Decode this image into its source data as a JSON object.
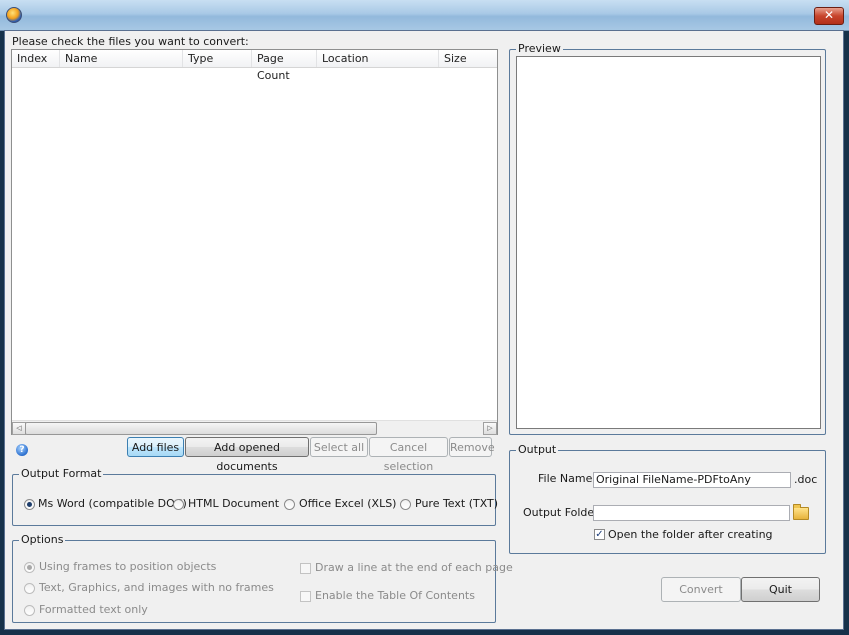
{
  "window": {
    "title": "",
    "close_label": "✕"
  },
  "files": {
    "instruction": "Please check the files you want to convert:",
    "columns": [
      "Index",
      "Name",
      "Type",
      "Page Count",
      "Location",
      "Size"
    ],
    "rows": []
  },
  "file_buttons": {
    "add_files": "Add files",
    "add_opened": "Add opened documents",
    "select_all": "Select all",
    "cancel_selection": "Cancel selection",
    "remove": "Remove"
  },
  "output_format": {
    "title": "Output Format",
    "options": [
      "Ms Word (compatible DOC)",
      "HTML Document",
      "Office Excel (XLS)",
      "Pure Text (TXT)"
    ],
    "selected": "Ms Word (compatible DOC)"
  },
  "options": {
    "title": "Options",
    "radios": [
      "Using frames to position objects",
      "Text, Graphics, and images with no frames",
      "Formatted text only"
    ],
    "checks": [
      "Draw a line at the end of each page",
      "Enable the Table Of Contents"
    ]
  },
  "preview": {
    "title": "Preview"
  },
  "output": {
    "title": "Output",
    "file_name_label": "File Name",
    "file_name_value": "Original FileName-PDFtoAny",
    "extension": ".doc",
    "folder_label": "Output Folder",
    "folder_value": "",
    "open_folder_label": "Open the folder after creating",
    "open_folder_checked": true
  },
  "actions": {
    "convert": "Convert",
    "quit": "Quit"
  }
}
